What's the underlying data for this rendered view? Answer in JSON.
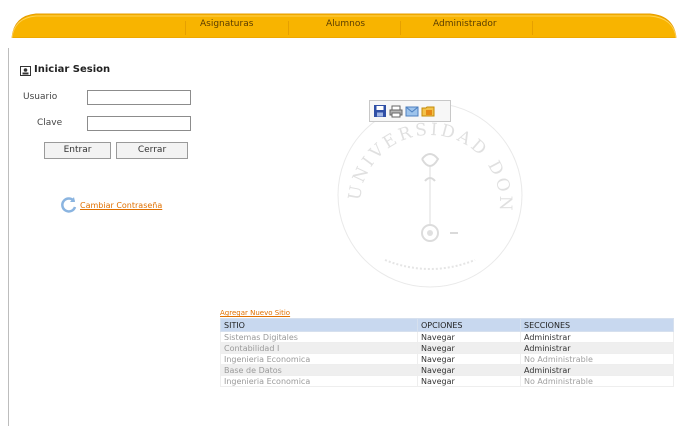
{
  "nav": {
    "items": [
      "Asignaturas",
      "Alumnos",
      "Administrador"
    ]
  },
  "login": {
    "title": "Iniciar Sesion",
    "user_label": "Usuario",
    "user_value": "",
    "pass_label": "Clave",
    "pass_value": "",
    "enter_button": "Entrar",
    "close_button": "Cerrar",
    "change_password_link": "Cambiar Contraseña"
  },
  "table": {
    "top_link": "Agregar Nuevo Sitio",
    "headers": [
      "SITIO",
      "OPCIONES",
      "SECCIONES"
    ],
    "rows": [
      [
        "Sistemas Digitales",
        "Navegar",
        "Administrar"
      ],
      [
        "Contabilidad I",
        "Navegar",
        "Administrar"
      ],
      [
        "Ingenieria Economica",
        "Navegar",
        "No Administrable"
      ],
      [
        "Base de Datos",
        "Navegar",
        "Administrar"
      ],
      [
        "Ingenieria Economica",
        "Navegar",
        "No Administrable"
      ]
    ]
  },
  "watermark": {
    "text_top": "UNIVERSIDAD DON BOSCO"
  },
  "colors": {
    "nav_orange": "#f8b400",
    "link_orange": "#e07000",
    "table_header": "#c8d8ef"
  }
}
